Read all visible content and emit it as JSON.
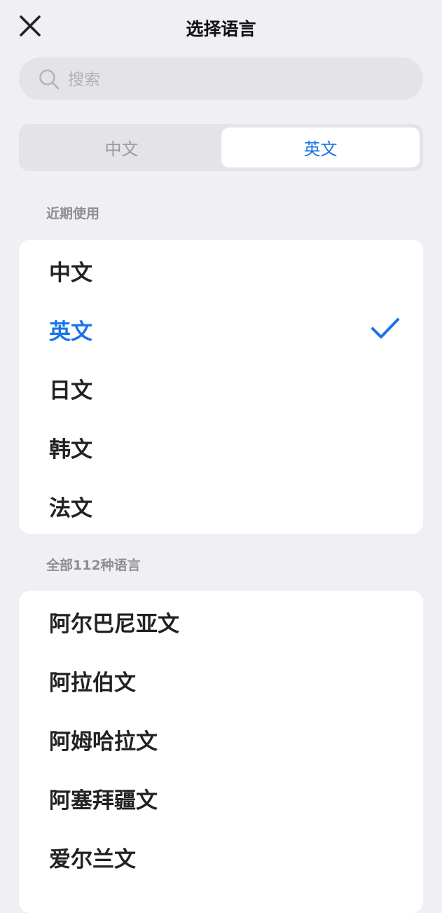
{
  "header": {
    "title": "选择语言"
  },
  "search": {
    "placeholder": "搜索"
  },
  "segment": {
    "tabs": [
      "中文",
      "英文"
    ],
    "selected": "英文"
  },
  "recent": {
    "label": "近期使用",
    "items": [
      "中文",
      "英文",
      "日文",
      "韩文",
      "法文"
    ],
    "selected": "英文"
  },
  "all": {
    "label": "全部112种语言",
    "items": [
      "阿尔巴尼亚文",
      "阿拉伯文",
      "阿姆哈拉文",
      "阿塞拜疆文",
      "爱尔兰文"
    ]
  },
  "colors": {
    "accent": "#1a73e8",
    "background": "#efeff4"
  },
  "icons": {
    "close": "close-icon",
    "search": "search-icon",
    "check": "check-icon"
  }
}
